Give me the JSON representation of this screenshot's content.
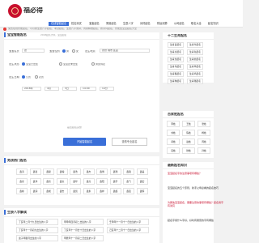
{
  "header": {
    "logo_text": "福必得",
    "nav": [
      "在线智能起名",
      "姓名测试",
      "宝宝起名",
      "周易起名",
      "生辰八字",
      "诗词起名",
      "财运测算",
      "公司起名",
      "取名大全",
      "起名知识"
    ],
    "notice": "免费在线智能起名，可以按生辰八字起名，考试起名，生辰八字测算，周易精准起名，按诗词起名，智能给宝宝起名大全"
  },
  "form": {
    "title": "宝宝智能起名",
    "subtitle": "2018起名大师，宝宝起名",
    "surname_label": "宝宝姓氏",
    "surname_value": "张",
    "gender_label": "宝宝性别",
    "gender_options": [
      "男",
      "女"
    ],
    "birthplace_label": "出生地点",
    "birthplace_value": "省份 城市 区县",
    "birth_status_label": "出生状态",
    "birth_status_options": [
      "宝宝已出生",
      "宝宝还未出生",
      "男女待定"
    ],
    "calendar_label": "出生日期",
    "calendar_options": [
      "公历",
      "农历"
    ],
    "date_fields": [
      "2018年",
      "4月",
      "3日",
      "14:00",
      "14分"
    ],
    "extra_text": "是否起名完整",
    "submit_label": "开始智能起名",
    "secondary_label": "查看专业起名"
  },
  "names_section": {
    "title": "男孩热门起名",
    "chips": [
      [
        "鑫涛",
        "鑫嘉",
        "鑫骏",
        "鑫翰",
        "鑫浩",
        "鑫杰",
        "鑫博",
        "鑫瑞",
        "鑫锐",
        "鑫昊"
      ],
      [
        "鑫家",
        "鑫洋",
        "鑫哲",
        "鑫文",
        "鑫华",
        "鑫亮",
        "鑫阳",
        "鑫宇",
        "鑫飞",
        "鑫宏"
      ],
      [
        "鑫彬",
        "鑫润",
        "鑫成",
        "鑫志",
        "鑫凯",
        "鑫永",
        "鑫祥",
        "鑫超",
        "鑫强",
        "鑫辉"
      ]
    ]
  },
  "bazi_section": {
    "title": "生辰八字解读",
    "links": [
      [
        "丁亥年二月十九日出生的八字",
        "甲申年四月初二出生的八字",
        "壬申年十一月十一日出生的八字"
      ],
      [
        "丁亥年十一月初九出生的八字",
        "丁亥年十一月廿十日出生的八字",
        "己亥年十二月十一日出生的八字"
      ],
      [
        "庚子年腊月出生的八字",
        "甲辰年十一月初二日出生的八字",
        ""
      ]
    ]
  },
  "sidebar": {
    "popular_title": "十二生肖起名",
    "popular": [
      [
        "生肖鼠起名",
        "生肖牛起名"
      ],
      [
        "生肖虎起名",
        "生肖兔起名"
      ],
      [
        "生肖龙起名",
        "生肖蛇起名"
      ],
      [
        "生肖马起名",
        "生肖羊起名"
      ],
      [
        "生肖猴起名",
        "生肖鸡起名"
      ],
      [
        "生肖狗起名",
        "生肖猪起名"
      ]
    ],
    "surnames_title": "百家姓起名",
    "surnames": [
      [
        "李姓",
        "王姓",
        "张姓"
      ],
      [
        "刘姓",
        "陈姓",
        "杨姓"
      ],
      [
        "黄姓",
        "赵姓",
        "周姓"
      ],
      [
        "吴姓",
        "徐姓",
        "孙姓"
      ]
    ],
    "articles_title": "最新起名知识",
    "articles": [
      "宝宝起名字的注意事项有哪些？",
      "宝宝起名的五个原则，新手父母必看的起名技巧",
      "为属兔宝宝起名，需要注意的事项有哪些？起名用字有讲究",
      "起名字用什么字好，好听有寓意的字有哪些"
    ]
  }
}
